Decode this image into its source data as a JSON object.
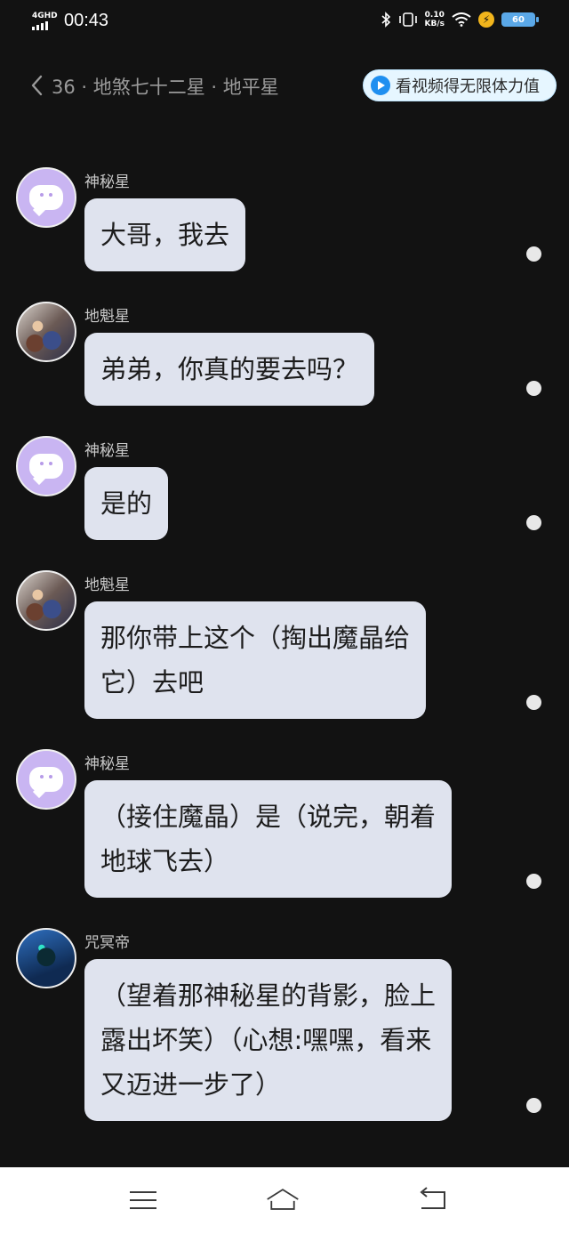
{
  "status_bar": {
    "network": "4GHD",
    "time": "00:43",
    "speed_value": "0.10",
    "speed_unit": "KB/s",
    "battery": "60",
    "icons": [
      "bluetooth-icon",
      "vibrate-icon",
      "wifi-icon",
      "charging-icon",
      "battery-icon"
    ]
  },
  "header": {
    "title": "36 · 地煞七十二星 · 地平星",
    "promo_label": "看视频得无限体力值"
  },
  "messages": [
    {
      "user": "神秘星",
      "avatar": "purple-chat-avatar",
      "lines": [
        "大哥，我去"
      ]
    },
    {
      "user": "地魁星",
      "avatar": "character-photo-avatar",
      "lines": [
        "弟弟，你真的要去吗？"
      ]
    },
    {
      "user": "神秘星",
      "avatar": "purple-chat-avatar",
      "lines": [
        "是的"
      ]
    },
    {
      "user": "地魁星",
      "avatar": "character-photo-avatar",
      "lines": [
        "那你带上这个（掏出魔晶给",
        "它）去吧"
      ]
    },
    {
      "user": "神秘星",
      "avatar": "purple-chat-avatar",
      "lines": [
        "（接住魔晶）是（说完，朝着",
        "地球飞去）"
      ]
    },
    {
      "user": "咒冥帝",
      "avatar": "hooded-figure-avatar",
      "lines": [
        "（望着那神秘星的背影，脸上",
        "露出坏笑）（心想:嘿嘿，看来",
        "又迈进一步了）"
      ]
    }
  ],
  "nav_bar": {
    "icons": [
      "menu-icon",
      "home-icon",
      "back-icon"
    ]
  },
  "colors": {
    "background": "#121212",
    "bubble": "#dfe3ee",
    "avatar_purple": "#c9b5f2",
    "promo_bg": "#e6f6ff",
    "battery": "#5aa8e8"
  }
}
